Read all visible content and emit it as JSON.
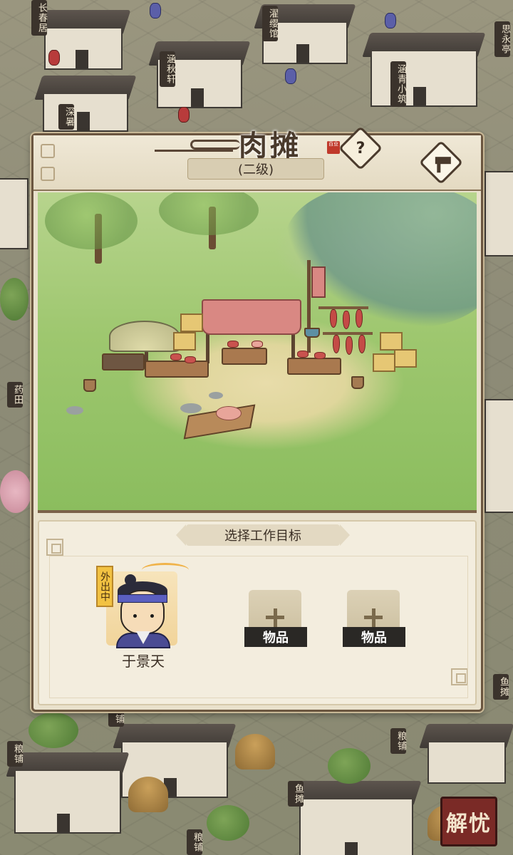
{
  "building": {
    "title": "肉摊",
    "seal": "百业",
    "level": "(二级)",
    "help_icon": "?"
  },
  "work": {
    "header": "选择工作目标",
    "worker": {
      "name": "于景天",
      "status": "外出中"
    },
    "slots": [
      {
        "label": "物品"
      },
      {
        "label": "物品"
      }
    ]
  },
  "map_signs": [
    "长春居",
    "濯缨馆",
    "思永亭",
    "涵秋轩",
    "涵青小筑",
    "深暑",
    "药田",
    "粮铺",
    "鱼摊",
    "粮铺",
    "鱼摊",
    "粮铺",
    "粮铺",
    "铺"
  ],
  "corner_button": {
    "label": "解忧"
  },
  "colors": {
    "panel_bg": "#e9e1cc",
    "panel_border": "#6b5640",
    "status_tag": "#f2c242",
    "slot_label_bg": "#2a2825"
  }
}
